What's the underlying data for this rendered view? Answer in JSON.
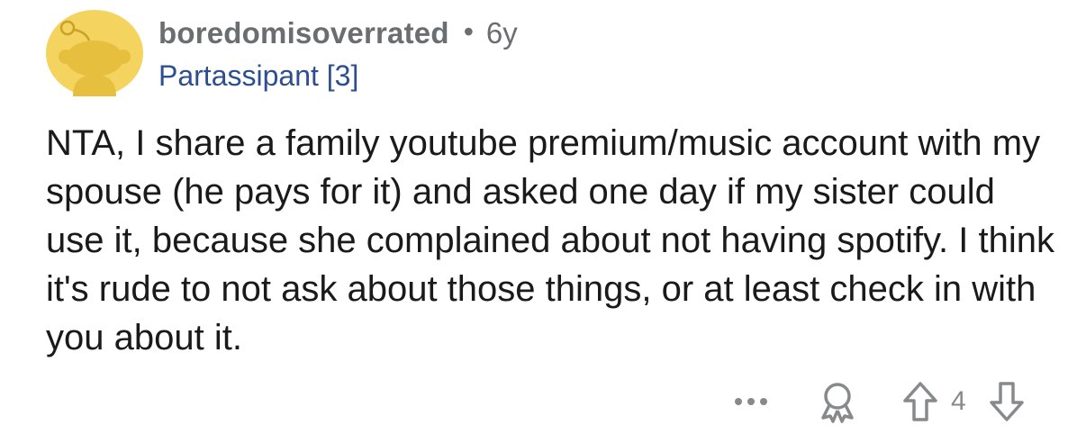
{
  "comment": {
    "author": "boredomisoverrated",
    "separator": "•",
    "age": "6y",
    "flair": "Partassipant [3]",
    "body": "NTA, I share a family youtube premium/music account with my spouse (he pays for it) and asked one day if my sister could use it, because she complained about not having spotify. I think it's rude to not ask about those things, or at least check in with you about it.",
    "score": "4"
  },
  "icons": {
    "avatar": "snoo-avatar",
    "more": "more-options-icon",
    "award": "award-icon",
    "upvote": "upvote-arrow-icon",
    "downvote": "downvote-arrow-icon"
  },
  "colors": {
    "avatar_bg": "#f4d35e",
    "username": "#6b6e70",
    "flair": "#2e4f8f",
    "body_text": "#1a1a1b",
    "action_icons": "#878a8c"
  }
}
